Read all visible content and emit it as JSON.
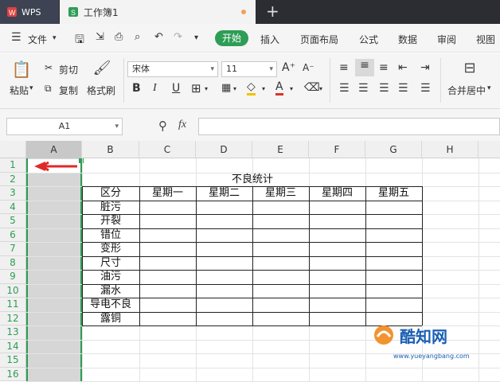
{
  "tabs": {
    "app": "WPS",
    "doc": "工作簿1",
    "plus": "+"
  },
  "menu": {
    "file": "文件",
    "start": "开始",
    "items": [
      "插入",
      "页面布局",
      "公式",
      "数据",
      "审阅",
      "视图"
    ]
  },
  "ribbon": {
    "paste": "粘贴",
    "cut": "剪切",
    "copy": "复制",
    "format_painter": "格式刷",
    "font": "宋体",
    "size": "11",
    "bold": "B",
    "italic": "I",
    "underline": "U",
    "merge": "合并居中"
  },
  "formula": {
    "cell_ref": "A1",
    "fx": "fx",
    "content": ""
  },
  "sheet": {
    "columns": [
      "A",
      "B",
      "C",
      "D",
      "E",
      "F",
      "G",
      "H"
    ],
    "rows": [
      "1",
      "2",
      "3",
      "4",
      "5",
      "6",
      "7",
      "8",
      "9",
      "10",
      "11",
      "12",
      "13",
      "14",
      "15",
      "16"
    ],
    "title": "不良统计",
    "header": [
      "区分",
      "星期一",
      "星期二",
      "星期三",
      "星期四",
      "星期五"
    ],
    "categories": [
      "脏污",
      "开裂",
      "错位",
      "变形",
      "尺寸",
      "油污",
      "漏水",
      "导电不良",
      "露铜"
    ]
  },
  "watermark": {
    "brand": "酷知网",
    "url": "www.yueyangbang.com"
  }
}
